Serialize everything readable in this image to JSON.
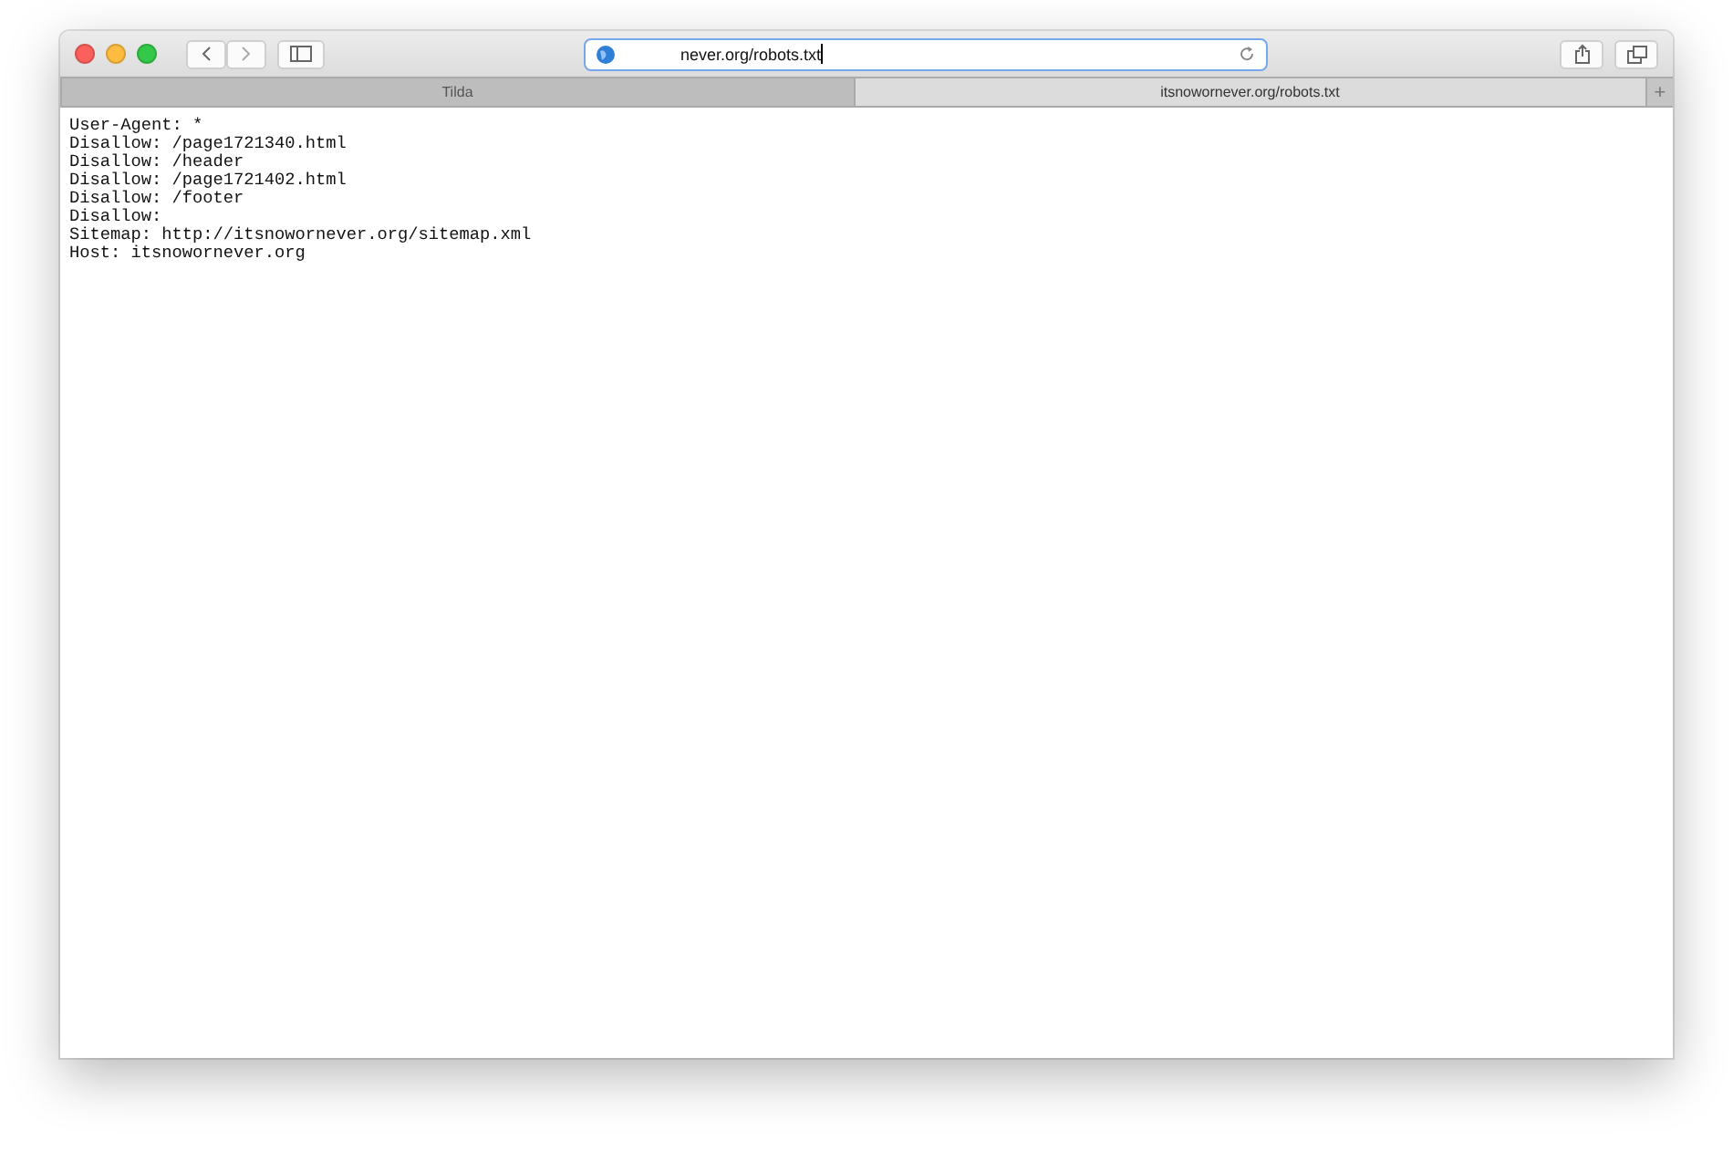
{
  "address_bar": {
    "value": "never.org/robots.txt",
    "focused": true
  },
  "tabs": [
    {
      "label": "Tilda",
      "selected": false
    },
    {
      "label": "itsnowornever.org/robots.txt",
      "selected": true
    }
  ],
  "new_tab": {
    "label": "+"
  },
  "content": {
    "lines": [
      "User-Agent: *",
      "Disallow: /page1721340.html",
      "Disallow: /header",
      "Disallow: /page1721402.html",
      "Disallow: /footer",
      "Disallow:",
      "Sitemap: http://itsnowornever.org/sitemap.xml",
      "Host: itsnowornever.org"
    ]
  }
}
